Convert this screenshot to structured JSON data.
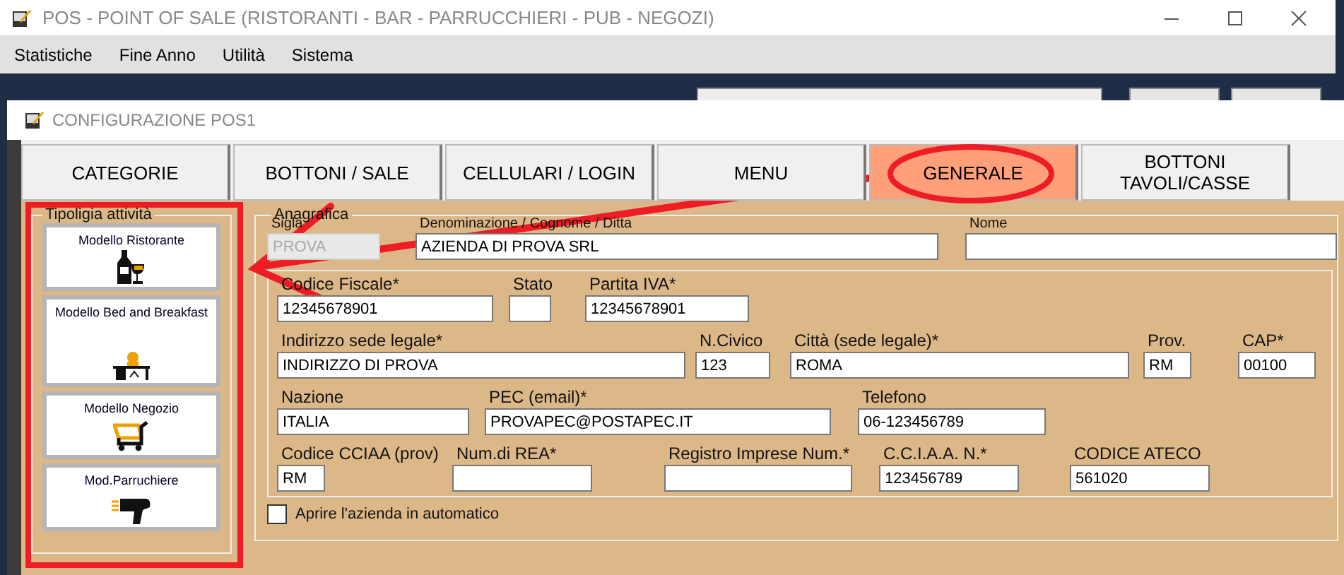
{
  "window": {
    "title": "POS - POINT OF SALE (RISTORANTI - BAR - PARRUCCHIERI - PUB - NEGOZI)"
  },
  "menu": [
    "Statistiche",
    "Fine Anno",
    "Utilità",
    "Sistema"
  ],
  "dialog": {
    "title": "CONFIGURAZIONE POS1"
  },
  "tabs": [
    {
      "label": "CATEGORIE",
      "selected": false
    },
    {
      "label": "BOTTONI / SALE",
      "selected": false
    },
    {
      "label": "CELLULARI / LOGIN",
      "selected": false
    },
    {
      "label": "MENU",
      "selected": false
    },
    {
      "label": "GENERALE",
      "selected": true
    },
    {
      "label": "BOTTONI TAVOLI/CASSE",
      "selected": false
    }
  ],
  "activity_panel": {
    "title": "Tipoligia attività",
    "buttons": [
      {
        "label": "Modello Ristorante"
      },
      {
        "label": "Modello Bed and Breakfast"
      },
      {
        "label": "Modello Negozio"
      },
      {
        "label": "Mod.Parruchiere"
      }
    ]
  },
  "anagrafica": {
    "title": "Anagrafica",
    "top_fields": [
      {
        "label": "Sigla",
        "value": "PROVA",
        "disabled": true
      },
      {
        "label": "Denominazione / Cognome / Ditta",
        "value": "AZIENDA DI PROVA SRL",
        "disabled": false
      },
      {
        "label": "Nome",
        "disabled": false
      }
    ],
    "fields": [
      {
        "label": "Codice Fiscale*",
        "value": "12345678901",
        "disabled": false
      },
      {
        "label": "Stato",
        "disabled": false
      },
      {
        "label": "Partita IVA*",
        "value": "12345678901",
        "disabled": false
      },
      {
        "label": "Indirizzo sede legale*",
        "value": "INDIRIZZO DI PROVA",
        "disabled": false
      },
      {
        "label": "N.Civico",
        "value": "123",
        "disabled": false
      },
      {
        "label": "Città  (sede legale)*",
        "value": "ROMA",
        "disabled": false
      },
      {
        "label": "Prov.",
        "value": "RM",
        "disabled": false
      },
      {
        "label": "CAP*",
        "value": "00100",
        "disabled": false
      },
      {
        "label": "Nazione",
        "value": "ITALIA",
        "disabled": false
      },
      {
        "label": "PEC (email)*",
        "value": "PROVAPEC@POSTAPEC.IT",
        "disabled": false
      },
      {
        "label": "Telefono",
        "value": "06-123456789",
        "disabled": false
      },
      {
        "label": "Codice CCIAA (prov)",
        "value": "RM",
        "disabled": false
      },
      {
        "label": "Num.di REA*",
        "disabled": false
      },
      {
        "label": "Registro Imprese Num.*",
        "disabled": false
      },
      {
        "label": "C.C.I.A.A. N.*",
        "value": "123456789",
        "disabled": false
      },
      {
        "label": "CODICE ATECO",
        "value": "561020",
        "disabled": false
      }
    ],
    "auto_open": {
      "label": "Aprire l'azienda in automatico",
      "checked": false
    }
  }
}
